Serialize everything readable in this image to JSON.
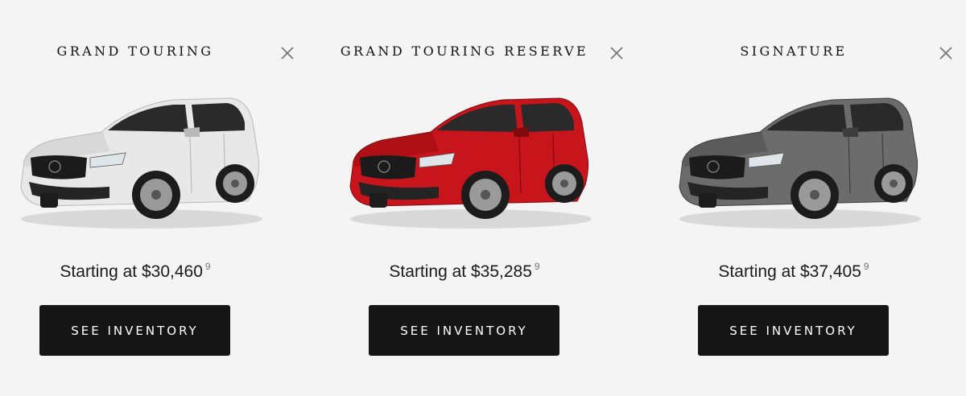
{
  "cards": [
    {
      "title": "GRAND TOURING",
      "price": "Starting at $30,460",
      "footnote": "9",
      "button_label": "SEE INVENTORY",
      "car_color": "#e8e8e8",
      "car_shade": "#b9b9b9"
    },
    {
      "title": "GRAND TOURING RESERVE",
      "price": "Starting at $35,285",
      "footnote": "9",
      "button_label": "SEE INVENTORY",
      "car_color": "#c8151b",
      "car_shade": "#7e0a0e"
    },
    {
      "title": "SIGNATURE",
      "price": "Starting at $37,405",
      "footnote": "9",
      "button_label": "SEE INVENTORY",
      "car_color": "#6c6c6c",
      "car_shade": "#3d3d3d"
    }
  ],
  "icons": {
    "close": "close-icon"
  }
}
